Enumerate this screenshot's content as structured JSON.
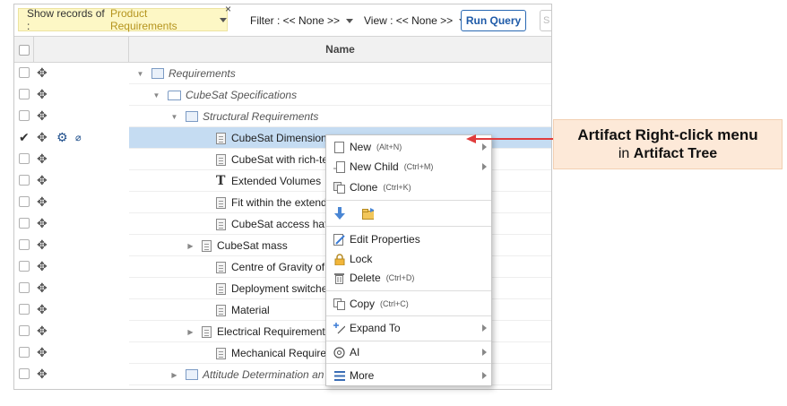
{
  "toolbar": {
    "show_records_label": "Show records of :",
    "show_records_value": "Product Requirements",
    "close_symbol": "×",
    "filter_label": "Filter : << None >>",
    "view_label": "View : << None >>",
    "run_query": "Run Query",
    "search_placeholder": "S"
  },
  "grid": {
    "column_name": "Name",
    "rows": [
      {
        "label": "Requirements",
        "type": "folder",
        "expander": "▼",
        "italic": true
      },
      {
        "label": "CubeSat Specifications",
        "type": "folder-open",
        "expander": "▼",
        "italic": true
      },
      {
        "label": "Structural Requirements",
        "type": "folder",
        "expander": "▼",
        "italic": true
      },
      {
        "label": "CubeSat Dimensions",
        "type": "doc",
        "expander": "",
        "italic": false,
        "selected": true
      },
      {
        "label": "CubeSat with rich-text",
        "type": "doc",
        "expander": "",
        "italic": false
      },
      {
        "label": "Extended Volumes",
        "type": "text",
        "expander": "",
        "italic": false
      },
      {
        "label": "Fit within the extended",
        "type": "doc",
        "expander": "",
        "italic": false
      },
      {
        "label": "CubeSat access hatche",
        "type": "doc",
        "expander": "",
        "italic": false
      },
      {
        "label": "CubeSat mass",
        "type": "doc",
        "expander": "▶",
        "italic": false
      },
      {
        "label": "Centre of Gravity of Cu",
        "type": "doc",
        "expander": "",
        "italic": false
      },
      {
        "label": "Deployment switches",
        "type": "doc",
        "expander": "",
        "italic": false
      },
      {
        "label": "Material",
        "type": "doc",
        "expander": "",
        "italic": false
      },
      {
        "label": "Electrical Requirement",
        "type": "doc",
        "expander": "▶",
        "italic": false
      },
      {
        "label": "Mechanical Requireme",
        "type": "doc",
        "expander": "",
        "italic": false
      },
      {
        "label": "Attitude Determination an",
        "type": "folder",
        "expander": "▶",
        "italic": true
      }
    ]
  },
  "context_menu": {
    "items": [
      {
        "label": "New",
        "shortcut": "(Alt+N)",
        "icon": "new-doc-icon",
        "submenu": true
      },
      {
        "label": "New Child",
        "shortcut": "(Ctrl+M)",
        "icon": "new-child-icon",
        "submenu": true
      },
      {
        "label": "Clone",
        "shortcut": "(Ctrl+K)",
        "icon": "clone-icon",
        "submenu": false
      },
      {
        "label": "Edit Properties",
        "shortcut": "",
        "icon": "edit-properties-icon",
        "submenu": false
      },
      {
        "label": "Lock",
        "shortcut": "",
        "icon": "lock-icon",
        "submenu": false
      },
      {
        "label": "Delete",
        "shortcut": "(Ctrl+D)",
        "icon": "trash-icon",
        "submenu": false
      },
      {
        "label": "Copy",
        "shortcut": "(Ctrl+C)",
        "icon": "copy-icon",
        "submenu": false
      },
      {
        "label": "Expand To",
        "shortcut": "",
        "icon": "expand-to-icon",
        "submenu": true
      },
      {
        "label": "AI",
        "shortcut": "",
        "icon": "ai-icon",
        "submenu": true
      },
      {
        "label": "More",
        "shortcut": "",
        "icon": "hamburger-icon",
        "submenu": true
      }
    ]
  },
  "callout": {
    "line1": "Artifact Right-click menu",
    "line2_prefix": "in",
    "line2_bold": "Artifact Tree"
  },
  "colors": {
    "selection": "#c5dcf2",
    "accent_blue": "#1e5aa8",
    "callout_bg": "#fde9d8",
    "pointer_red": "#e03c3c",
    "show_records_bg": "#fdf7c5"
  }
}
